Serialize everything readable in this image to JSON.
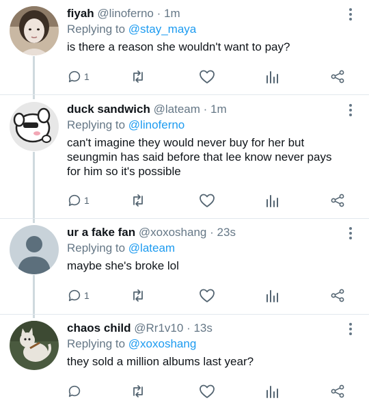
{
  "tweets": [
    {
      "name": "fiyah",
      "handle": "@linoferno",
      "separator": "·",
      "time": "1m",
      "replying_prefix": "Replying to",
      "replying_to": "@stay_maya",
      "text": "is there a reason she wouldn't want to pay?",
      "reply_count": "1",
      "avatar": "photo-avatar"
    },
    {
      "name": "duck sandwich",
      "handle": "@lateam",
      "separator": "·",
      "time": "1m",
      "replying_prefix": "Replying to",
      "replying_to": "@linoferno",
      "text": "can't imagine they would never buy for her but seungmin has said before that lee know never pays for him so it's possible",
      "reply_count": "1",
      "avatar": "cartoon-avatar"
    },
    {
      "name": "ur a fake fan",
      "handle": "@xoxoshang",
      "separator": "·",
      "time": "23s",
      "replying_prefix": "Replying to",
      "replying_to": "@lateam",
      "text": "maybe she's broke lol",
      "reply_count": "1",
      "avatar": "default-avatar"
    },
    {
      "name": "chaos child",
      "handle": "@Rr1v10",
      "separator": "·",
      "time": "13s",
      "replying_prefix": "Replying to",
      "replying_to": "@xoxoshang",
      "text": "they sold a million albums last year?",
      "reply_count": "",
      "avatar": "cat-drawing-avatar"
    }
  ],
  "icons": {
    "reply": "reply-icon",
    "retweet": "retweet-icon",
    "like": "like-icon",
    "stats": "stats-icon",
    "share": "share-icon",
    "more": "more-vertical-icon"
  },
  "colors": {
    "accent": "#1d9bf0",
    "secondary_text": "#657786",
    "thread_line": "#cfd9de"
  }
}
